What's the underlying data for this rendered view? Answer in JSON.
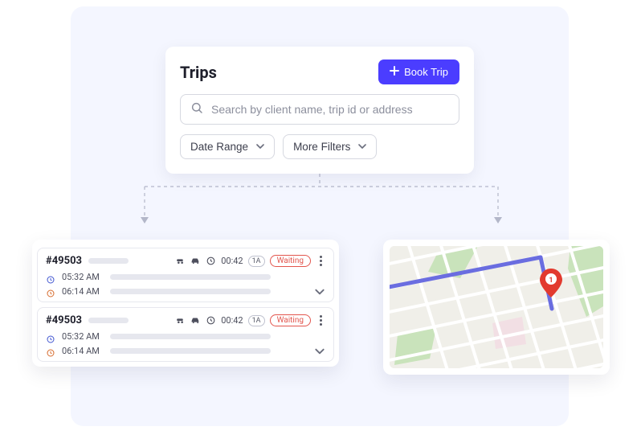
{
  "header": {
    "title": "Trips",
    "book_button": "Book Trip"
  },
  "search": {
    "placeholder": "Search by client name, trip id or address"
  },
  "filters": {
    "date_range": "Date Range",
    "more_filters": "More Filters"
  },
  "trips": [
    {
      "id": "#49503",
      "duration": "00:42",
      "passengers": "1A",
      "status": "Waiting",
      "pickup_time": "05:32 AM",
      "dropoff_time": "06:14 AM"
    },
    {
      "id": "#49503",
      "duration": "00:42",
      "passengers": "1A",
      "status": "Waiting",
      "pickup_time": "05:32 AM",
      "dropoff_time": "06:14 AM"
    }
  ],
  "map": {
    "pin_label": "1"
  },
  "colors": {
    "accent": "#4b3dff",
    "danger": "#e2554d"
  }
}
